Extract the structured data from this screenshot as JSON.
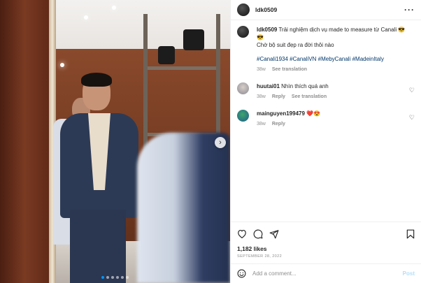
{
  "post": {
    "username": "ldk0509",
    "more_icon": "more-horizontal-icon",
    "more_label": "···"
  },
  "caption": {
    "username": "ldk0509",
    "text": "Trải nghiệm dịch vụ made to measure từ Canali 😎😎",
    "line2": "Chờ bộ suit đẹp ra đời thôi nào",
    "hashtags": [
      "#Canali1934",
      "#CanaliVN",
      "#MebyCanali",
      "#MadeinItaly"
    ],
    "time": "38w",
    "translate": "See translation"
  },
  "comments": [
    {
      "username": "huutai01",
      "text": "Nhìn thích quá anh",
      "time": "38w",
      "reply": "Reply",
      "translate": "See translation"
    },
    {
      "username": "mainguyen199479",
      "text": "❤️😍",
      "time": "38w",
      "reply": "Reply"
    }
  ],
  "stats": {
    "likes": "1,182 likes",
    "date": "SEPTEMBER 28, 2022"
  },
  "composer": {
    "placeholder": "Add a comment...",
    "post_label": "Post"
  },
  "carousel": {
    "dot_count": 6,
    "active_index": 0,
    "next_icon": "chevron-right-icon"
  },
  "colors": {
    "link": "#00376b",
    "muted": "#8e8e8e",
    "post_disabled": "#b2dffc",
    "active_dot": "#0095f6"
  }
}
